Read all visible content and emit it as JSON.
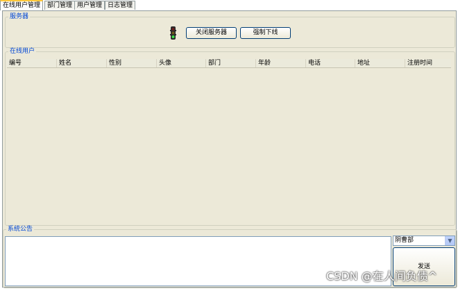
{
  "tabs": [
    "在线用户管理",
    "部门管理",
    "用户管理",
    "日志管理"
  ],
  "server": {
    "legend": "服务器",
    "icon": "traffic-light-icon",
    "close_label": "关闭服务器",
    "kick_label": "强制下线"
  },
  "online": {
    "legend": "在线用户",
    "columns": [
      "编号",
      "姓名",
      "性别",
      "头像",
      "部门",
      "年龄",
      "电话",
      "地址",
      "注册时间"
    ],
    "rows": []
  },
  "announce": {
    "legend": "系统公告",
    "message": "",
    "dept_selected": "阴曹部",
    "send_label": "发送"
  },
  "watermark": "CSDN @在人间负债^"
}
